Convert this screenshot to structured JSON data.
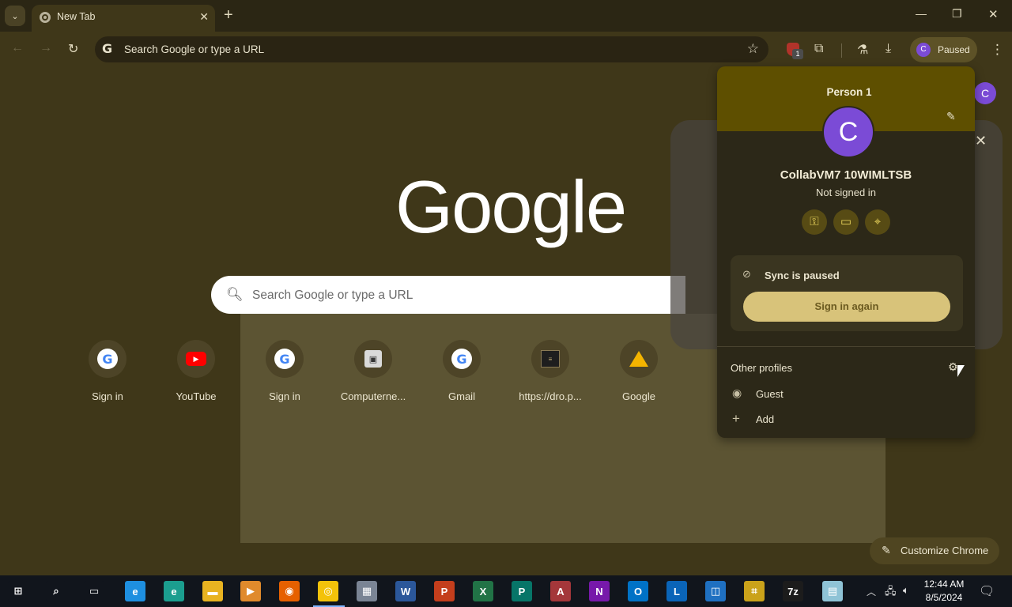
{
  "browser": {
    "tab_title": "New Tab",
    "omnibox_placeholder": "Search Google or type a URL",
    "ublock_badge": "1",
    "profile_chip": {
      "initial": "C",
      "label": "Paused"
    }
  },
  "ntp": {
    "logo": "Google",
    "search_placeholder": "Search Google or type a URL",
    "avatar_initial": "C",
    "shortcuts": [
      {
        "label": "Sign in",
        "icon": "google-icon"
      },
      {
        "label": "YouTube",
        "icon": "youtube-icon"
      },
      {
        "label": "Sign in",
        "icon": "google-icon"
      },
      {
        "label": "Computerne...",
        "icon": "computer-icon"
      },
      {
        "label": "Gmail",
        "icon": "google-icon"
      },
      {
        "label": "https://dro.p...",
        "icon": "document-icon"
      },
      {
        "label": "Google",
        "icon": "google-drive-icon"
      }
    ],
    "customize_label": "Customize Chrome"
  },
  "profile_popup": {
    "person_label": "Person 1",
    "avatar_initial": "C",
    "name": "CollabVM7 10WIMLTSB",
    "status": "Not signed in",
    "quick_icons": [
      "password-key-icon",
      "payment-card-icon",
      "address-pin-icon"
    ],
    "sync_title": "Sync is paused",
    "sign_in_button": "Sign in again",
    "other_profiles_label": "Other profiles",
    "guest_label": "Guest",
    "add_label": "Add"
  },
  "taskbar": {
    "apps": [
      {
        "name": "start",
        "glyph": "⊞",
        "color": "#11151c"
      },
      {
        "name": "search",
        "glyph": "⌕",
        "color": "#11151c"
      },
      {
        "name": "task-view",
        "glyph": "▭",
        "color": "#11151c"
      },
      {
        "name": "internet-explorer",
        "glyph": "e",
        "color": "#1e8fe0"
      },
      {
        "name": "edge-can",
        "glyph": "e",
        "color": "#1b9e8f"
      },
      {
        "name": "file-explorer",
        "glyph": "▬",
        "color": "#e8b321"
      },
      {
        "name": "media-player",
        "glyph": "▶",
        "color": "#e08a2c"
      },
      {
        "name": "firefox",
        "glyph": "◉",
        "color": "#e66000"
      },
      {
        "name": "chrome-canary",
        "glyph": "◎",
        "color": "#f3c20a"
      },
      {
        "name": "network-computer",
        "glyph": "▦",
        "color": "#7a8494"
      },
      {
        "name": "word",
        "glyph": "W",
        "color": "#2b579a"
      },
      {
        "name": "powerpoint",
        "glyph": "P",
        "color": "#c43e1c"
      },
      {
        "name": "excel",
        "glyph": "X",
        "color": "#217346"
      },
      {
        "name": "publisher",
        "glyph": "P",
        "color": "#077568"
      },
      {
        "name": "access",
        "glyph": "A",
        "color": "#a4373a"
      },
      {
        "name": "onenote",
        "glyph": "N",
        "color": "#7719aa"
      },
      {
        "name": "outlook",
        "glyph": "O",
        "color": "#0072c6"
      },
      {
        "name": "lync",
        "glyph": "L",
        "color": "#0a64b8"
      },
      {
        "name": "virtualbox",
        "glyph": "◫",
        "color": "#1f70c1"
      },
      {
        "name": "winrar-tool",
        "glyph": "⌗",
        "color": "#caa21a"
      },
      {
        "name": "7zip",
        "glyph": "7z",
        "color": "#1c1c1c"
      },
      {
        "name": "notepad-app",
        "glyph": "▤",
        "color": "#8fc3d6"
      }
    ],
    "time": "12:44 AM",
    "date": "8/5/2024"
  }
}
